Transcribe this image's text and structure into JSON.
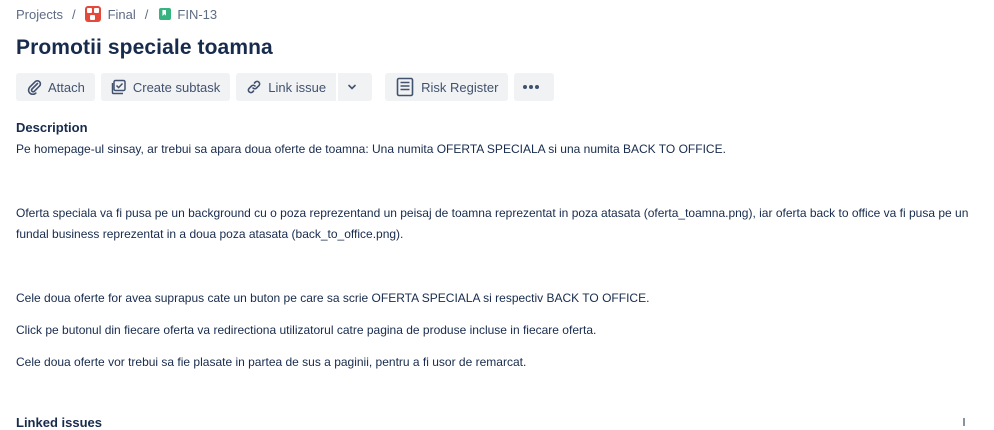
{
  "breadcrumb": {
    "root": "Projects",
    "separator": "/",
    "project": "Final",
    "issue_key": "FIN-13"
  },
  "issue": {
    "title": "Promotii speciale toamna"
  },
  "toolbar": {
    "attach": "Attach",
    "create_subtask": "Create subtask",
    "link_issue": "Link issue",
    "risk_register": "Risk Register"
  },
  "description": {
    "label": "Description",
    "paragraphs": [
      "Pe homepage-ul sinsay, ar trebui sa apara doua oferte  de toamna: Una numita OFERTA SPECIALA si una numita BACK TO OFFICE.",
      "Oferta speciala va fi pusa pe un background cu o poza reprezentand un peisaj de toamna reprezentat in poza atasata (oferta_toamna.png), iar oferta back to office va fi pusa pe un fundal business reprezentat in a doua poza atasata (back_to_office.png).",
      "Cele doua oferte for avea suprapus cate un buton pe care sa scrie OFERTA SPECIALA si respectiv BACK TO OFFICE.",
      "Click pe butonul din fiecare oferta va redirectiona utilizatorul catre pagina de produse incluse in fiecare oferta.",
      "Cele doua oferte vor trebui sa fie plasate in partea de sus a paginii, pentru a fi usor de remarcat."
    ]
  },
  "linked": {
    "label": "Linked issues"
  },
  "colors": {
    "project_icon": "#e5493a",
    "story_icon": "#36b37e",
    "button_bg": "#f1f2f4",
    "text": "#172b4d"
  }
}
